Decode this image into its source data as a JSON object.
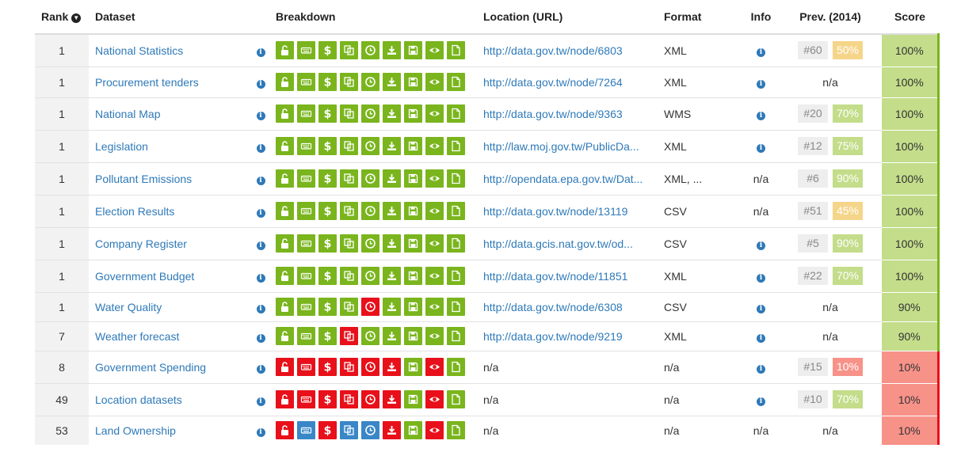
{
  "headers": {
    "rank": "Rank",
    "dataset": "Dataset",
    "breakdown": "Breakdown",
    "location": "Location (URL)",
    "format": "Format",
    "info": "Info",
    "prev": "Prev. (2014)",
    "score": "Score"
  },
  "colors": {
    "green": "#7ab51d",
    "red": "#e8101a",
    "blue": "#3a87c8",
    "score_high_bg": "#c3dd8a",
    "score_high_border": "#7ab51d",
    "score_low_bg": "#f79289",
    "score_low_border": "#e8101a",
    "prev_mid": "#f5d58a",
    "prev_good": "#c3dd8a",
    "prev_bad": "#f79289"
  },
  "breakdown_icons": [
    "open-license-icon",
    "keyboard-icon",
    "dollar-icon",
    "copy-icon",
    "clock-icon",
    "download-icon",
    "save-icon",
    "eye-icon",
    "file-icon"
  ],
  "rows": [
    {
      "rank": "1",
      "dataset": "National Statistics",
      "breakdown": [
        "green",
        "green",
        "green",
        "green",
        "green",
        "green",
        "green",
        "green",
        "green"
      ],
      "url": "http://data.gov.tw/node/6803",
      "format": "XML",
      "info": "icon",
      "prev_rank": "#60",
      "prev_score": "50%",
      "prev_color": "mid",
      "score": "100%",
      "score_level": "high"
    },
    {
      "rank": "1",
      "dataset": "Procurement tenders",
      "breakdown": [
        "green",
        "green",
        "green",
        "green",
        "green",
        "green",
        "green",
        "green",
        "green"
      ],
      "url": "http://data.gov.tw/node/7264",
      "format": "XML",
      "info": "icon",
      "prev_na": "n/a",
      "score": "100%",
      "score_level": "high"
    },
    {
      "rank": "1",
      "dataset": "National Map",
      "breakdown": [
        "green",
        "green",
        "green",
        "green",
        "green",
        "green",
        "green",
        "green",
        "green"
      ],
      "url": "http://data.gov.tw/node/9363",
      "format": "WMS",
      "info": "icon",
      "prev_rank": "#20",
      "prev_score": "70%",
      "prev_color": "good",
      "score": "100%",
      "score_level": "high"
    },
    {
      "rank": "1",
      "dataset": "Legislation",
      "breakdown": [
        "green",
        "green",
        "green",
        "green",
        "green",
        "green",
        "green",
        "green",
        "green"
      ],
      "url": "http://law.moj.gov.tw/PublicDa...",
      "format": "XML",
      "info": "icon",
      "prev_rank": "#12",
      "prev_score": "75%",
      "prev_color": "good",
      "score": "100%",
      "score_level": "high"
    },
    {
      "rank": "1",
      "dataset": "Pollutant Emissions",
      "breakdown": [
        "green",
        "green",
        "green",
        "green",
        "green",
        "green",
        "green",
        "green",
        "green"
      ],
      "url": "http://opendata.epa.gov.tw/Dat...",
      "format": "XML, ...",
      "info": "n/a",
      "prev_rank": "#6",
      "prev_score": "90%",
      "prev_color": "good",
      "score": "100%",
      "score_level": "high"
    },
    {
      "rank": "1",
      "dataset": "Election Results",
      "breakdown": [
        "green",
        "green",
        "green",
        "green",
        "green",
        "green",
        "green",
        "green",
        "green"
      ],
      "url": "http://data.gov.tw/node/13119",
      "format": "CSV",
      "info": "n/a",
      "prev_rank": "#51",
      "prev_score": "45%",
      "prev_color": "mid",
      "score": "100%",
      "score_level": "high"
    },
    {
      "rank": "1",
      "dataset": "Company Register",
      "breakdown": [
        "green",
        "green",
        "green",
        "green",
        "green",
        "green",
        "green",
        "green",
        "green"
      ],
      "url": "http://data.gcis.nat.gov.tw/od...",
      "format": "CSV",
      "info": "icon",
      "prev_rank": "#5",
      "prev_score": "90%",
      "prev_color": "good",
      "score": "100%",
      "score_level": "high"
    },
    {
      "rank": "1",
      "dataset": "Government Budget",
      "breakdown": [
        "green",
        "green",
        "green",
        "green",
        "green",
        "green",
        "green",
        "green",
        "green"
      ],
      "url": "http://data.gov.tw/node/11851",
      "format": "XML",
      "info": "icon",
      "prev_rank": "#22",
      "prev_score": "70%",
      "prev_color": "good",
      "score": "100%",
      "score_level": "high"
    },
    {
      "rank": "1",
      "dataset": "Water Quality",
      "breakdown": [
        "green",
        "green",
        "green",
        "green",
        "red",
        "green",
        "green",
        "green",
        "green"
      ],
      "url": "http://data.gov.tw/node/6308",
      "format": "CSV",
      "info": "icon",
      "prev_na": "n/a",
      "score": "90%",
      "score_level": "high"
    },
    {
      "rank": "7",
      "dataset": "Weather forecast",
      "breakdown": [
        "green",
        "green",
        "green",
        "red",
        "green",
        "green",
        "green",
        "green",
        "green"
      ],
      "url": "http://data.gov.tw/node/9219",
      "format": "XML",
      "info": "icon",
      "prev_na": "n/a",
      "score": "90%",
      "score_level": "high"
    },
    {
      "rank": "8",
      "dataset": "Government Spending",
      "breakdown": [
        "red",
        "red",
        "red",
        "red",
        "red",
        "red",
        "green",
        "red",
        "green"
      ],
      "url_na": "n/a",
      "format": "n/a",
      "info": "icon",
      "prev_rank": "#15",
      "prev_score": "10%",
      "prev_color": "bad",
      "score": "10%",
      "score_level": "low"
    },
    {
      "rank": "49",
      "dataset": "Location datasets",
      "breakdown": [
        "red",
        "red",
        "red",
        "red",
        "red",
        "red",
        "green",
        "red",
        "green"
      ],
      "url_na": "n/a",
      "format": "n/a",
      "info": "icon",
      "prev_rank": "#10",
      "prev_score": "70%",
      "prev_color": "good",
      "score": "10%",
      "score_level": "low"
    },
    {
      "rank": "53",
      "dataset": "Land Ownership",
      "breakdown": [
        "red",
        "blue",
        "red",
        "blue",
        "blue",
        "red",
        "green",
        "red",
        "green"
      ],
      "url_na": "n/a",
      "format": "n/a",
      "info": "n/a",
      "prev_na": "n/a",
      "score": "10%",
      "score_level": "low"
    }
  ]
}
